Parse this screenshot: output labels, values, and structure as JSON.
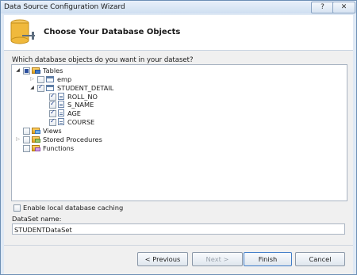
{
  "window": {
    "title": "Data Source Configuration Wizard",
    "help_icon": "help-icon",
    "close_icon": "close-icon"
  },
  "header": {
    "title": "Choose Your Database Objects",
    "icon": "database-icon"
  },
  "main": {
    "question": "Which database objects do you want in your dataset?",
    "tree": {
      "tables_label": "Tables",
      "emp_label": "emp",
      "student_detail_label": "STUDENT_DETAIL",
      "columns": [
        "ROLL_NO",
        "S_NAME",
        "AGE",
        "COURSE"
      ],
      "views_label": "Views",
      "procs_label": "Stored Procedures",
      "functions_label": "Functions"
    },
    "caching_label": "Enable local database caching",
    "dataset_name_label": "DataSet name:",
    "dataset_name_value": "STUDENTDataSet"
  },
  "buttons": {
    "previous": "< Previous",
    "next": "Next >",
    "finish": "Finish",
    "cancel": "Cancel"
  }
}
